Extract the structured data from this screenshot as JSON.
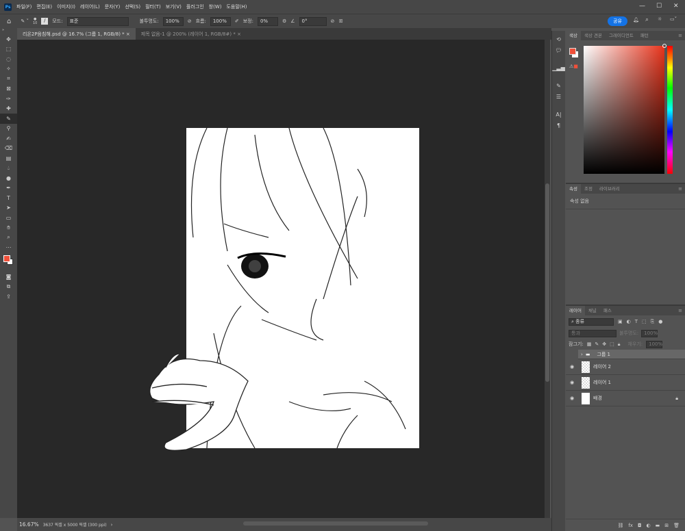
{
  "menu": {
    "logo": "Ps",
    "items": [
      "파일(F)",
      "편집(E)",
      "이미지(I)",
      "레이어(L)",
      "문자(Y)",
      "선택(S)",
      "필터(T)",
      "보기(V)",
      "플러그인",
      "창(W)",
      "도움말(H)"
    ]
  },
  "options": {
    "brush_size": "10",
    "mode_label": "모드:",
    "mode_value": "표준",
    "opacity_label": "불투명도:",
    "opacity_value": "100%",
    "flow_label": "흐름:",
    "flow_value": "100%",
    "smoothing_label": "보정:",
    "smoothing_value": "0%",
    "angle_value": "0°",
    "share_label": "공유"
  },
  "tabs": [
    {
      "label": "리온2P음침해.psd @ 16.7% (그룹 1, RGB/8) *"
    },
    {
      "label": "제목 없음-1 @ 200% (레이어 1, RGB/8#) *"
    }
  ],
  "status": {
    "zoom": "16.67%",
    "info": "3637 픽셀 x 5000 픽셀 (300 ppi)"
  },
  "colors": {
    "foreground": "#f0503a",
    "background": "#ffffff",
    "accent": "#1473e6"
  },
  "color_panel": {
    "tabs": [
      "색상",
      "색상 견본",
      "그레이디언트",
      "패턴"
    ]
  },
  "properties_panel": {
    "tabs": [
      "속성",
      "조정",
      "라이브러리"
    ],
    "message": "속성 없음"
  },
  "layers_panel": {
    "tabs": [
      "레이어",
      "채널",
      "패스"
    ],
    "filter_label": "종류",
    "blend_mode": "통과",
    "opacity_label": "불투명도:",
    "opacity_value": "100%",
    "lock_label": "잠그기:",
    "fill_label": "채우기:",
    "fill_value": "100%",
    "layers": [
      {
        "name": "그룹 1",
        "type": "group"
      },
      {
        "name": "레이어 2",
        "type": "layer"
      },
      {
        "name": "레이어 1",
        "type": "layer"
      },
      {
        "name": "배경",
        "type": "background"
      }
    ]
  }
}
